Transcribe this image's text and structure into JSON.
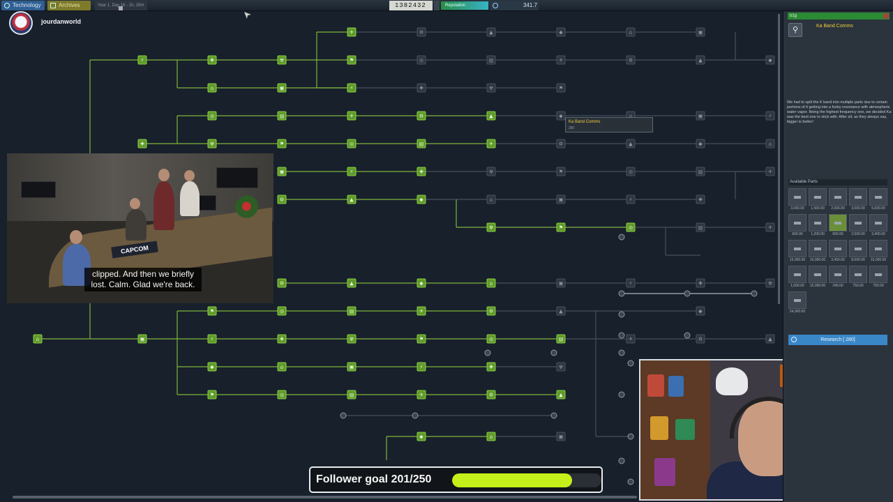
{
  "topbar": {
    "tabs": [
      {
        "label": "Technology",
        "icon": "gear-icon",
        "active": true
      },
      {
        "label": "Archives",
        "icon": "archive-icon",
        "active": false
      }
    ],
    "date": "Year 1, Day 16 - 1h, 26m",
    "funds": "1382432",
    "reputation_label": "Reputation",
    "science": "341.7"
  },
  "streamer": {
    "username": "jourdanworld"
  },
  "video": {
    "subtitle": "clipped. And then we briefly lost. Calm. Glad we're back.",
    "capcom_sign": "CAPCOM"
  },
  "goal": {
    "label": "Follower goal 201/250",
    "current": 201,
    "target": 250
  },
  "tooltip": {
    "title": "Ka Band Comms",
    "cost": "280"
  },
  "panel": {
    "header": "b1g",
    "part_title": "Ka Band Comms",
    "description": "We had to split the K band into multiple parts due to certain portions of it getting into a funky resonance with atmospheric water vapor. Being the highest frequency one, we decided Ka was the best one to stick with. After all, as they always say, bigger is better!",
    "available_parts_label": "Available Parts",
    "parts": [
      {
        "cost": "3,000.00"
      },
      {
        "cost": "1,500.00"
      },
      {
        "cost": "2,000.00"
      },
      {
        "cost": "3,000.00"
      },
      {
        "cost": "5,600.00"
      },
      {
        "cost": "600.00"
      },
      {
        "cost": "1,200.00"
      },
      {
        "cost": "600.00",
        "selected": true
      },
      {
        "cost": "2,500.00"
      },
      {
        "cost": "3,400.00"
      },
      {
        "cost": "15,000.00"
      },
      {
        "cost": "16,000.00"
      },
      {
        "cost": "3,400.00"
      },
      {
        "cost": "8,000.00"
      },
      {
        "cost": "15,000.00"
      },
      {
        "cost": "1,000.00"
      },
      {
        "cost": "15,000.00"
      },
      {
        "cost": "240.00"
      },
      {
        "cost": "750.00"
      },
      {
        "cost": "750.00"
      },
      {
        "cost": "24,000.00"
      }
    ],
    "research_button": "Research [ 280]"
  },
  "colors": {
    "unlocked_node": "#5f9a2a",
    "locked_node": "#2d3641",
    "accent_blue": "#3a87c8",
    "goal_fill": "#c5ef1a",
    "title_yellow": "#f0cf3e"
  }
}
